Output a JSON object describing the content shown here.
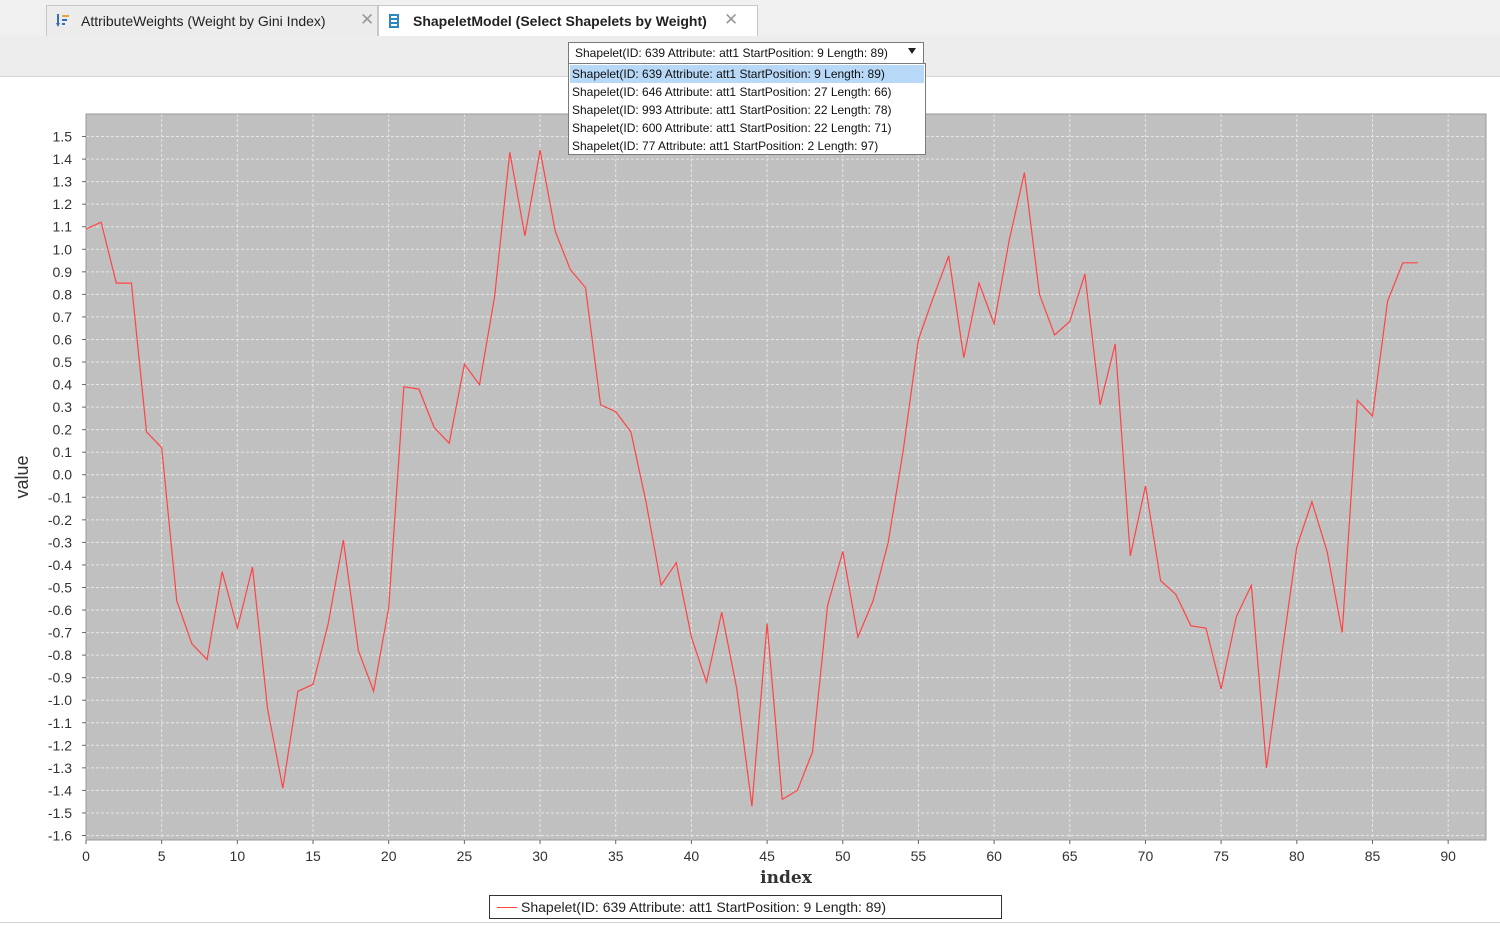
{
  "tabs": [
    {
      "label": "AttributeWeights (Weight by Gini Index)",
      "close": "✕",
      "icon": "weights-sort-icon",
      "active": false
    },
    {
      "label": "ShapeletModel (Select Shapelets by Weight)",
      "close": "✕",
      "icon": "model-icon",
      "active": true
    }
  ],
  "selector": {
    "selected": "Shapelet(ID: 639 Attribute: att1 StartPosition: 9 Length: 89)",
    "options": [
      "Shapelet(ID: 639 Attribute: att1 StartPosition: 9 Length: 89)",
      "Shapelet(ID: 646 Attribute: att1 StartPosition: 27 Length: 66)",
      "Shapelet(ID: 993 Attribute: att1 StartPosition: 22 Length: 78)",
      "Shapelet(ID: 600 Attribute: att1 StartPosition: 22 Length: 71)",
      "Shapelet(ID: 77 Attribute: att1 StartPosition: 2 Length: 97)"
    ]
  },
  "colors": {
    "plot_background": "#c0c0c0",
    "series": "#ff4444",
    "grid": "#e6e6e6",
    "selection": "#b8d8f7"
  },
  "chart_data": {
    "type": "line",
    "title": "",
    "xlabel": "index",
    "ylabel": "value",
    "xlim": [
      0,
      92.5
    ],
    "ylim": [
      -1.62,
      1.6
    ],
    "xticks": [
      0,
      5,
      10,
      15,
      20,
      25,
      30,
      35,
      40,
      45,
      50,
      55,
      60,
      65,
      70,
      75,
      80,
      85,
      90
    ],
    "yticks": [
      1.5,
      1.4,
      1.3,
      1.2,
      1.1,
      1.0,
      0.9,
      0.8,
      0.7,
      0.6,
      0.5,
      0.4,
      0.3,
      0.2,
      0.1,
      0.0,
      -0.1,
      -0.2,
      -0.3,
      -0.4,
      -0.5,
      -0.6,
      -0.7,
      -0.8,
      -0.9,
      -1.0,
      -1.1,
      -1.2,
      -1.3,
      -1.4,
      -1.5,
      -1.6
    ],
    "grid": true,
    "legend_position": "bottom-center",
    "series": [
      {
        "name": "Shapelet(ID: 639 Attribute: att1 StartPosition: 9 Length: 89)",
        "color": "#ff4444",
        "x": [
          0,
          1,
          2,
          3,
          4,
          5,
          6,
          7,
          8,
          9,
          10,
          11,
          12,
          13,
          14,
          15,
          16,
          17,
          18,
          19,
          20,
          21,
          22,
          23,
          24,
          25,
          26,
          27,
          28,
          29,
          30,
          31,
          32,
          33,
          34,
          35,
          36,
          37,
          38,
          39,
          40,
          41,
          42,
          43,
          44,
          45,
          46,
          47,
          48,
          49,
          50,
          51,
          52,
          53,
          54,
          55,
          56,
          57,
          58,
          59,
          60,
          61,
          62,
          63,
          64,
          65,
          66,
          67,
          68,
          69,
          70,
          71,
          72,
          73,
          74,
          75,
          76,
          77,
          78,
          79,
          80,
          81,
          82,
          83,
          84,
          85,
          86,
          87,
          88
        ],
        "y": [
          1.09,
          1.12,
          0.85,
          0.85,
          0.19,
          0.12,
          -0.56,
          -0.75,
          -0.82,
          -0.43,
          -0.68,
          -0.41,
          -1.04,
          -1.39,
          -0.96,
          -0.93,
          -0.66,
          -0.29,
          -0.78,
          -0.96,
          -0.59,
          0.39,
          0.38,
          0.21,
          0.14,
          0.49,
          0.4,
          0.79,
          1.43,
          1.06,
          1.44,
          1.08,
          0.91,
          0.83,
          0.31,
          0.28,
          0.19,
          -0.12,
          -0.49,
          -0.39,
          -0.72,
          -0.92,
          -0.61,
          -0.95,
          -1.47,
          -0.66,
          -1.44,
          -1.4,
          -1.23,
          -0.58,
          -0.34,
          -0.72,
          -0.56,
          -0.3,
          0.11,
          0.6,
          0.79,
          0.97,
          0.52,
          0.85,
          0.67,
          1.04,
          1.34,
          0.8,
          0.62,
          0.68,
          0.89,
          0.31,
          0.58,
          -0.36,
          -0.05,
          -0.47,
          -0.53,
          -0.67,
          -0.68,
          -0.95,
          -0.63,
          -0.49,
          -1.3,
          -0.8,
          -0.32,
          -0.12,
          -0.34,
          -0.7,
          0.33,
          0.26,
          0.77,
          0.94,
          0.94
        ]
      }
    ]
  }
}
